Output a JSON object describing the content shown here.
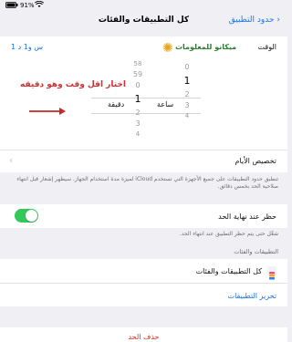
{
  "status": {
    "battery": "91%",
    "battery_icon": "battery-icon",
    "wifi_icon": "wifi-icon"
  },
  "nav": {
    "title": "كل التطبيقات والفئات",
    "back_label": "حدود التطبيق"
  },
  "time_row": {
    "label": "الوقت",
    "value": "1 س و1 د"
  },
  "watermark": {
    "text": "ميكانو للمعلومات"
  },
  "annotation": {
    "text": "اختار اقل وقت وهو دقيقه"
  },
  "picker": {
    "hours_above": [
      "",
      "",
      "0"
    ],
    "hours_selected": "1",
    "hours_unit": "ساعة",
    "hours_below": [
      "2",
      "3",
      "4"
    ],
    "minutes_above": [
      "58",
      "59",
      "0"
    ],
    "minutes_selected": "1",
    "minutes_unit": "دقيقة",
    "minutes_below": [
      "2",
      "3",
      "4"
    ]
  },
  "customize_days": {
    "label": "تخصيص الأيام"
  },
  "footnote_1": "تنطبق حدود التطبيقات على جميع الأجهزة التي تستخدم iCloud لميزة مدة استخدام الجهاز. سيظهر إشعار قبل انتهاء صلاحية الحد بخمس دقائق.",
  "block_limit": {
    "label": "حظر عند نهاية الحد",
    "enabled": true
  },
  "footnote_2": "شغّل حتى يتم حظر التطبيق عند انتهاء الحد.",
  "section_header": "التطبيقات والفئات",
  "apps_row": {
    "label": "كل التطبيقات والفئات",
    "icon": "layers-icon"
  },
  "edit_apps": {
    "label": "تحرير التطبيقات"
  },
  "delete_limit": {
    "label": "حذف الحد"
  },
  "colors": {
    "accent": "#1a73e8",
    "toggle_on": "#34c759",
    "destructive": "#e0301e",
    "annotation_red": "#d32f2f"
  }
}
